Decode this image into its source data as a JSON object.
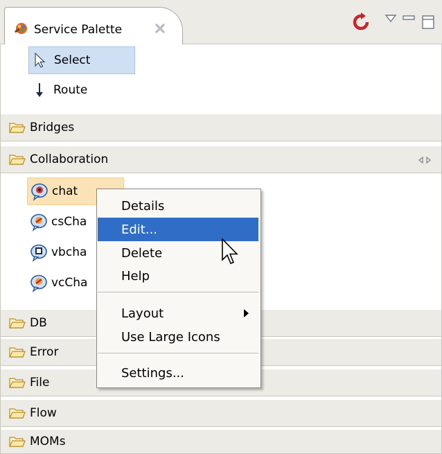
{
  "view": {
    "title": "Service Palette",
    "icons": {
      "view": "palette-icon",
      "close": "close-icon",
      "refresh": "refresh-icon",
      "menu": "view-menu-icon",
      "minimize": "minimize-icon",
      "maximize": "maximize-icon"
    }
  },
  "tools": [
    {
      "label": "Select",
      "icon": "arrow-pointer-icon",
      "selected": true
    },
    {
      "label": "Route",
      "icon": "route-arrow-icon",
      "selected": false
    }
  ],
  "drawers": [
    {
      "label": "Bridges",
      "expanded": false
    },
    {
      "label": "Collaboration",
      "expanded": true
    },
    {
      "label": "DB",
      "expanded": false
    },
    {
      "label": "Error",
      "expanded": false
    },
    {
      "label": "File",
      "expanded": false
    },
    {
      "label": "Flow",
      "expanded": false
    },
    {
      "label": "MOMs",
      "expanded": false
    }
  ],
  "collaboration_items": [
    {
      "label": "chat",
      "icon": "chat-service-icon",
      "hover": true
    },
    {
      "label": "csCha",
      "icon": "chat-service-icon"
    },
    {
      "label": "vbcha",
      "icon": "chat-service-icon"
    },
    {
      "label": "vcCha",
      "icon": "chat-service-icon"
    }
  ],
  "context_menu": {
    "items": [
      {
        "label": "Details"
      },
      {
        "label": "Edit...",
        "active": true
      },
      {
        "label": "Delete"
      },
      {
        "label": "Help"
      },
      {
        "label": "Layout",
        "submenu": true
      },
      {
        "label": "Use Large Icons"
      },
      {
        "label": "Settings..."
      }
    ]
  },
  "colors": {
    "menu_highlight": "#2f6dc7",
    "selection": "#cfe0f5",
    "hover": "#fbe3b7",
    "drawer_bg": "#ecebe6"
  }
}
